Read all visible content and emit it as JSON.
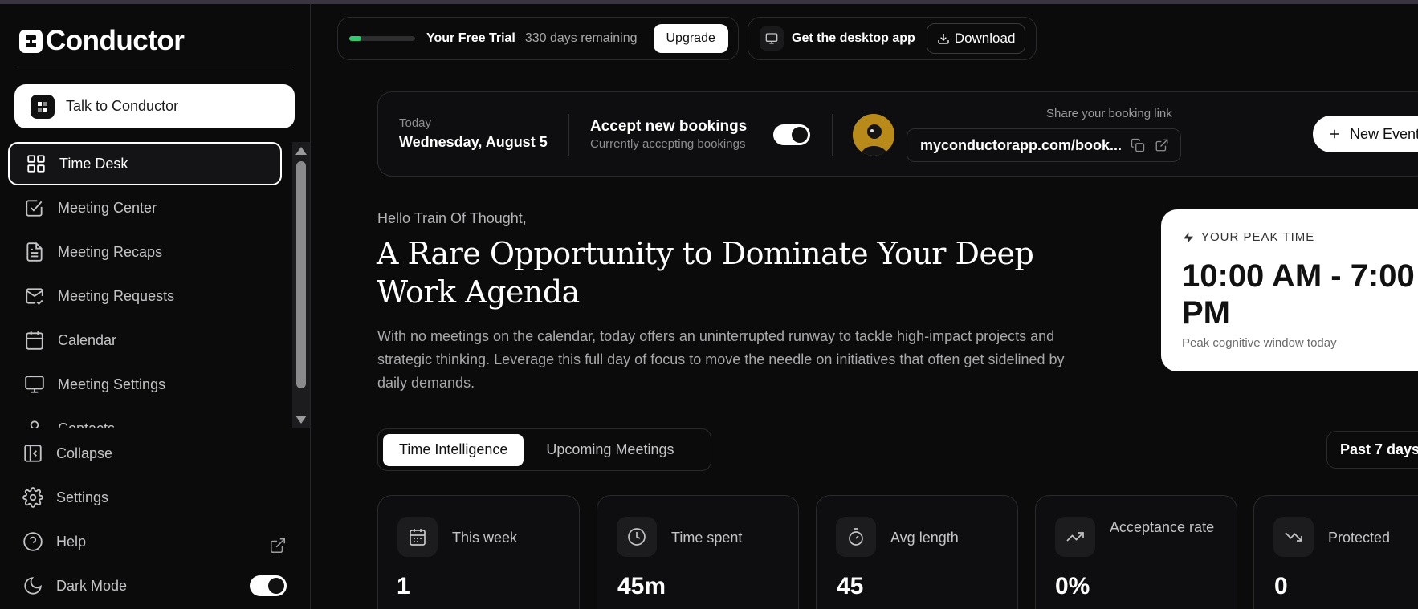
{
  "brand": {
    "name": "Conductor"
  },
  "sidebar": {
    "talk_button": "Talk to Conductor",
    "nav": [
      {
        "label": "Time Desk",
        "icon": "grid-icon",
        "active": true
      },
      {
        "label": "Meeting Center",
        "icon": "checkbox-icon"
      },
      {
        "label": "Meeting Recaps",
        "icon": "document-icon"
      },
      {
        "label": "Meeting Requests",
        "icon": "mail-check-icon"
      },
      {
        "label": "Calendar",
        "icon": "calendar-icon"
      },
      {
        "label": "Meeting Settings",
        "icon": "monitor-icon"
      },
      {
        "label": "Contacts",
        "icon": "user-icon"
      }
    ],
    "collapse": "Collapse",
    "settings": "Settings",
    "help": "Help",
    "dark_mode": "Dark Mode",
    "dark_mode_on": true
  },
  "topbar": {
    "trial_label": "Your Free Trial",
    "trial_days": "330 days remaining",
    "trial_progress": 0.18,
    "upgrade": "Upgrade",
    "desktop_label": "Get the desktop app",
    "download": "Download"
  },
  "booking": {
    "today_label": "Today",
    "today_date": "Wednesday, August 5",
    "accept_title": "Accept new bookings",
    "accept_sub": "Currently accepting bookings",
    "accepting": true,
    "share_label": "Share your booking link",
    "link": "myconductorapp.com/book...",
    "new_event": "New Event"
  },
  "greeting": {
    "hello": "Hello Train Of Thought,",
    "headline": "A Rare Opportunity to Dominate Your Deep Work Agenda",
    "description": "With no meetings on the calendar, today offers an uninterrupted runway to tackle high-impact projects and strategic thinking. Leverage this full day of focus to move the needle on initiatives that often get sidelined by daily demands."
  },
  "peak": {
    "label": "YOUR PEAK TIME",
    "time": "10:00 AM - 7:00 PM",
    "sub": "Peak cognitive window today"
  },
  "tabs": [
    {
      "label": "Time Intelligence",
      "active": true
    },
    {
      "label": "Upcoming Meetings",
      "active": false
    }
  ],
  "range": "Past 7 days",
  "stats": [
    {
      "label": "This week",
      "value": "1",
      "icon": "calendar-icon"
    },
    {
      "label": "Time spent",
      "value": "45m",
      "icon": "clock-icon"
    },
    {
      "label": "Avg length",
      "value": "45",
      "icon": "stopwatch-icon"
    },
    {
      "label": "Acceptance rate",
      "value": "0%",
      "icon": "trending-up-icon"
    },
    {
      "label": "Protected",
      "value": "0",
      "icon": "trending-down-icon"
    }
  ],
  "colors": {
    "accent_green": "#2ecc71",
    "background": "#0b0b0c",
    "surface": "#0e0e10"
  }
}
